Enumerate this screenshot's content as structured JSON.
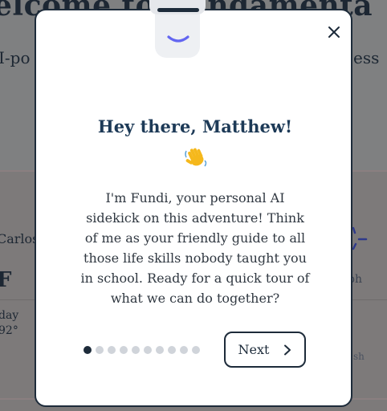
{
  "background": {
    "hero_title": "elcome to Fundamenta",
    "hero_subtitle_left": "I-po",
    "hero_subtitle_right": "ess",
    "location": "Carlos",
    "temp_unit": "F",
    "day_label": "day",
    "high_temp": "92°",
    "wind_1": "ph",
    "wind_2": "sh"
  },
  "modal": {
    "title": "Hey there, Matthew!",
    "emoji": "waving-hand",
    "body": "I'm Fundi, your personal AI sidekick on this adventure! Think of me as your friendly guide to all those life skills nobody taught you in school. Ready for a quick tour of what we can do together?",
    "next_label": "Next",
    "steps": {
      "total": 10,
      "current": 1
    }
  },
  "colors": {
    "accent": "#6366f1",
    "navy": "#1d2b3a",
    "title": "#1d3a57",
    "dot_inactive": "#d0d4da"
  }
}
